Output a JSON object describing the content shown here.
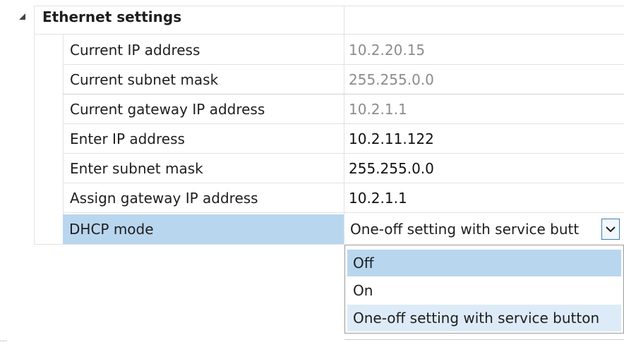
{
  "section": {
    "title": "Ethernet settings"
  },
  "rows": [
    {
      "name": "Current IP address",
      "value": "10.2.20.15"
    },
    {
      "name": "Current subnet mask",
      "value": "255.255.0.0"
    },
    {
      "name": "Current gateway IP address",
      "value": "10.2.1.1"
    },
    {
      "name": "Enter IP address",
      "value": "10.2.11.122"
    },
    {
      "name": "Enter subnet mask",
      "value": "255.255.0.0"
    },
    {
      "name": "Assign gateway IP address",
      "value": "10.2.1.1"
    }
  ],
  "dhcp": {
    "name": "DHCP mode",
    "selected_value": "One-off setting with service butt",
    "options": [
      "Off",
      "On",
      "One-off setting with service button"
    ]
  },
  "colors": {
    "selection": "#b9d6ef",
    "readonly_text": "#8c8c8c",
    "dropdown_button_border": "#3c7fb1"
  }
}
